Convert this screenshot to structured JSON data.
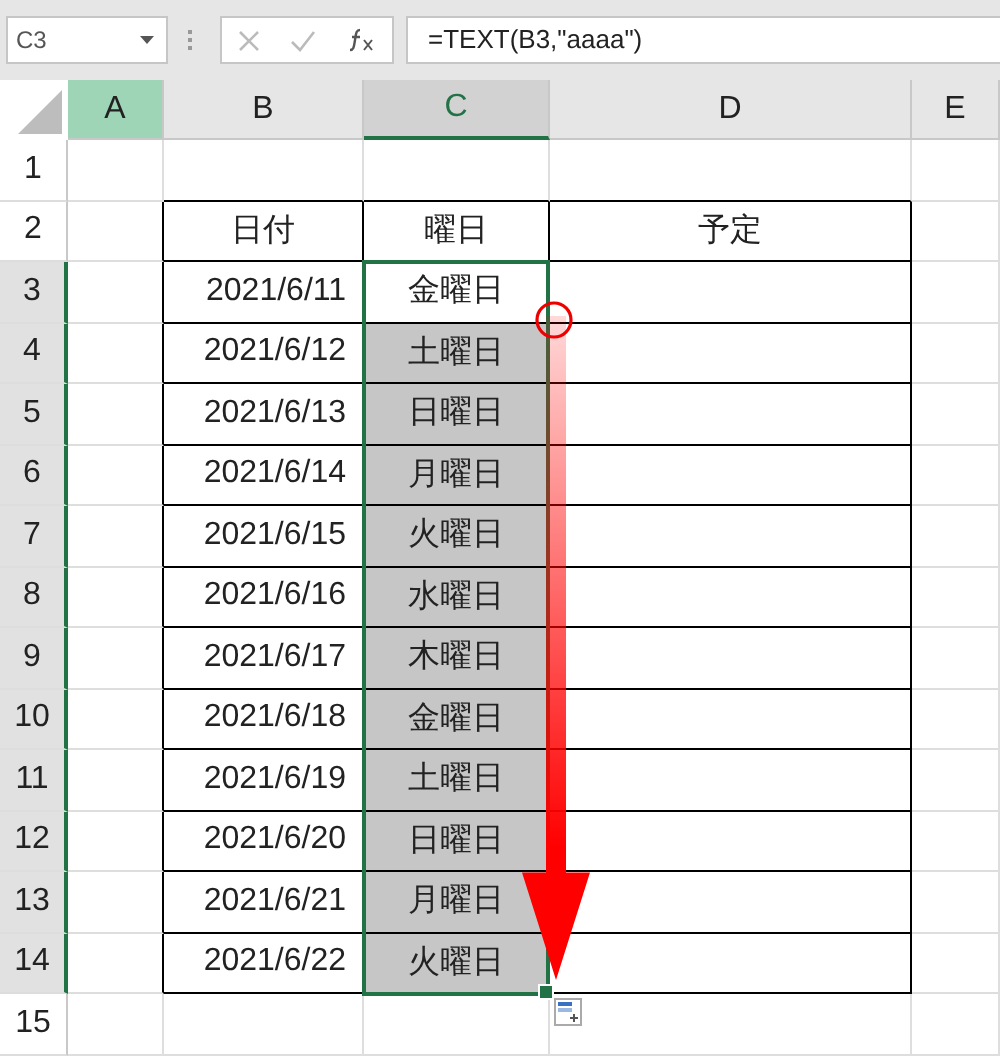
{
  "formula_bar": {
    "name_box": "C3",
    "formula": "=TEXT(B3,\"aaaa\")"
  },
  "columns": [
    {
      "label": "A",
      "highlighted": true,
      "selected": false
    },
    {
      "label": "B",
      "highlighted": false,
      "selected": false
    },
    {
      "label": "C",
      "highlighted": false,
      "selected": true
    },
    {
      "label": "D",
      "highlighted": false,
      "selected": false
    },
    {
      "label": "E",
      "highlighted": false,
      "selected": false
    }
  ],
  "row_headers": [
    {
      "label": "1",
      "selected": false
    },
    {
      "label": "2",
      "selected": false
    },
    {
      "label": "3",
      "selected": true
    },
    {
      "label": "4",
      "selected": true
    },
    {
      "label": "5",
      "selected": true
    },
    {
      "label": "6",
      "selected": true
    },
    {
      "label": "7",
      "selected": true
    },
    {
      "label": "8",
      "selected": true
    },
    {
      "label": "9",
      "selected": true
    },
    {
      "label": "10",
      "selected": true
    },
    {
      "label": "11",
      "selected": true
    },
    {
      "label": "12",
      "selected": true
    },
    {
      "label": "13",
      "selected": true
    },
    {
      "label": "14",
      "selected": true
    },
    {
      "label": "15",
      "selected": false
    }
  ],
  "table": {
    "headers": [
      "日付",
      "曜日",
      "予定"
    ],
    "rows": [
      {
        "date": "2021/6/11",
        "weekday": "金曜日",
        "selected": false
      },
      {
        "date": "2021/6/12",
        "weekday": "土曜日",
        "selected": true
      },
      {
        "date": "2021/6/13",
        "weekday": "日曜日",
        "selected": true
      },
      {
        "date": "2021/6/14",
        "weekday": "月曜日",
        "selected": true
      },
      {
        "date": "2021/6/15",
        "weekday": "火曜日",
        "selected": true
      },
      {
        "date": "2021/6/16",
        "weekday": "水曜日",
        "selected": true
      },
      {
        "date": "2021/6/17",
        "weekday": "木曜日",
        "selected": true
      },
      {
        "date": "2021/6/18",
        "weekday": "金曜日",
        "selected": true
      },
      {
        "date": "2021/6/19",
        "weekday": "土曜日",
        "selected": true
      },
      {
        "date": "2021/6/20",
        "weekday": "日曜日",
        "selected": true
      },
      {
        "date": "2021/6/21",
        "weekday": "月曜日",
        "selected": true
      },
      {
        "date": "2021/6/22",
        "weekday": "火曜日",
        "selected": true
      }
    ]
  }
}
